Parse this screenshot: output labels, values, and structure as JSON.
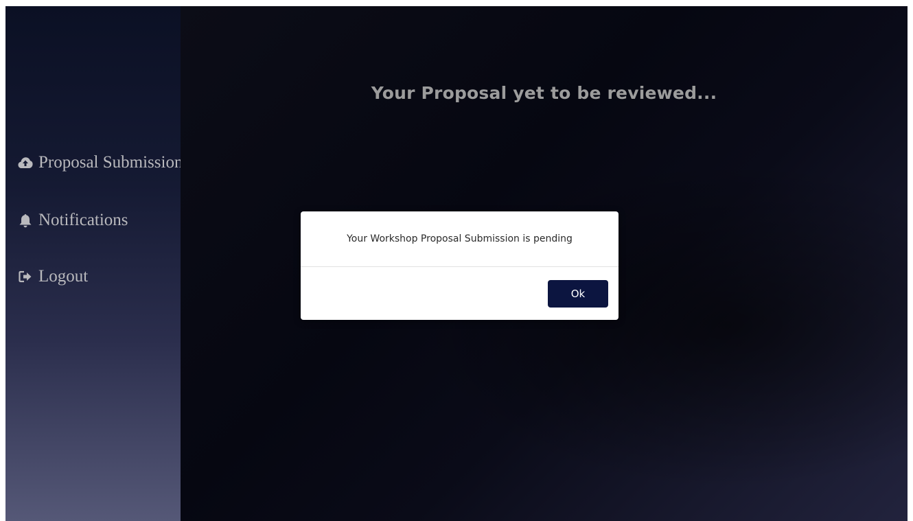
{
  "main": {
    "title": "Your Proposal yet to be reviewed..."
  },
  "sidebar": {
    "items": [
      {
        "label": "Proposal Submissions",
        "icon": "cloud-upload-icon"
      },
      {
        "label": "Notifications",
        "icon": "bell-icon"
      },
      {
        "label": "Logout",
        "icon": "sign-out-icon"
      }
    ]
  },
  "modal": {
    "message": "Your Workshop Proposal Submission is pending",
    "ok_label": "Ok"
  },
  "colors": {
    "button_bg": "#0c1540",
    "sidebar_text": "#b9b9bd",
    "title_text": "#9c9c9c"
  }
}
